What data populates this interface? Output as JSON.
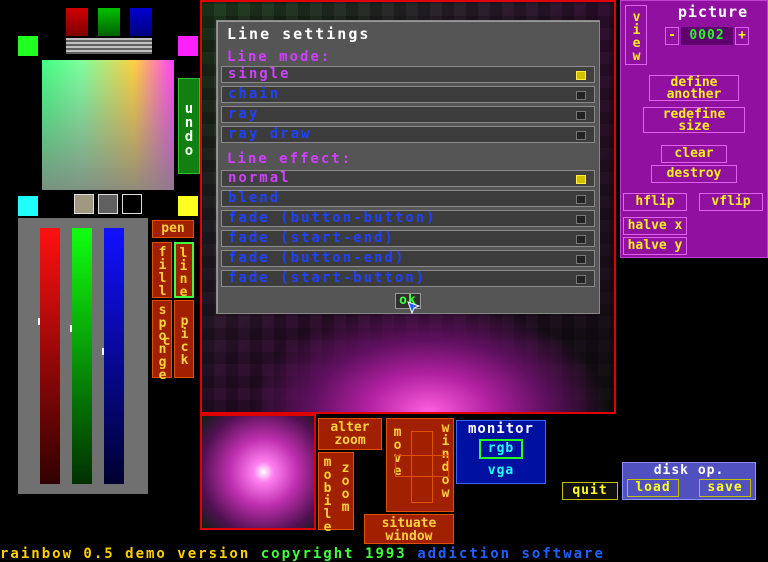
{
  "dialog": {
    "title": "Line settings",
    "mode_heading": "Line mode:",
    "modes": [
      {
        "label": "single",
        "checked": true
      },
      {
        "label": "chain",
        "checked": false
      },
      {
        "label": "ray",
        "checked": false
      },
      {
        "label": "ray draw",
        "checked": false
      }
    ],
    "effect_heading": "Line effect:",
    "effects": [
      {
        "label": "normal",
        "checked": true
      },
      {
        "label": "blend",
        "checked": false
      },
      {
        "label": "fade (button-button)",
        "checked": false
      },
      {
        "label": "fade (start-end)",
        "checked": false
      },
      {
        "label": "fade (button-end)",
        "checked": false
      },
      {
        "label": "fade (start-button)",
        "checked": false
      }
    ],
    "ok_label": "ok"
  },
  "tools": {
    "undo": "undo",
    "pen": "pen",
    "fill": "fill",
    "line": "line",
    "sponge": "sponge",
    "pick_c": "pick c"
  },
  "picture_panel": {
    "view": "view",
    "title": "picture",
    "minus": "-",
    "number": "0002",
    "plus": "+",
    "define_another": "define another",
    "redefine_size": "redefine size",
    "clear": "clear",
    "destroy": "destroy",
    "hflip": "hflip",
    "vflip": "vflip",
    "halve_x": "halve x",
    "halve_y": "halve y"
  },
  "bottom": {
    "alter_zoom": "alter zoom",
    "mobile": "mobile",
    "zoom": "zoom",
    "move": "move",
    "window": "window",
    "situate_window": "situate window",
    "monitor": "monitor",
    "rgb": "rgb",
    "vga": "vga",
    "quit": "quit",
    "disk_op": "disk op.",
    "load": "load",
    "save": "save"
  },
  "footer": {
    "product": "rainbow 0.5 demo version",
    "copyright": "copyright 1993",
    "company": "addiction software"
  },
  "colors": {
    "frame_red": "#e00000",
    "dialog_bg": "#555555",
    "option_text": "#2040ff",
    "heading_text": "#d040ff",
    "panel_purple": "#9010a0",
    "button_yellow": "#ffee20",
    "tool_bg": "#a02000",
    "footer_yellow": "#ffd000",
    "footer_green": "#40ff40",
    "footer_blue": "#2060ff"
  },
  "sliders": {
    "red": 0.65,
    "green": 0.62,
    "blue": 0.53
  }
}
